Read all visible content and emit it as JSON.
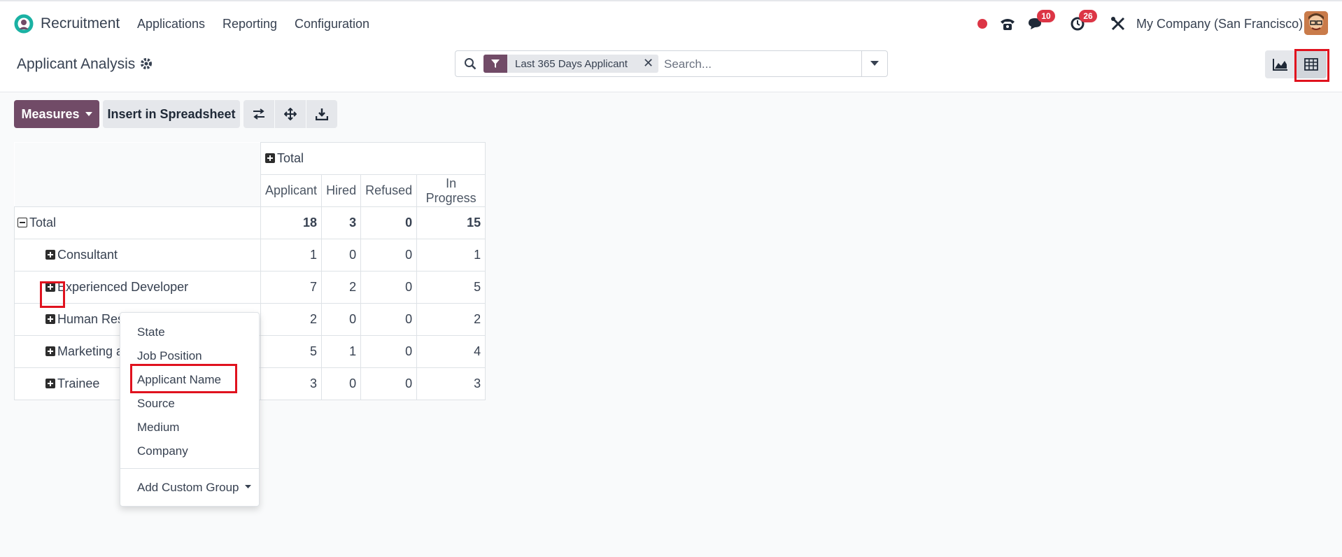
{
  "app": {
    "name": "Recruitment"
  },
  "nav": [
    {
      "label": "Applications"
    },
    {
      "label": "Reporting"
    },
    {
      "label": "Configuration"
    }
  ],
  "systray": {
    "messages_count": "10",
    "activities_count": "26",
    "company": "My Company (San Francisco)"
  },
  "page": {
    "title": "Applicant Analysis"
  },
  "search": {
    "facet_label": "Last 365 Days Applicant",
    "placeholder": "Search..."
  },
  "toolbar": {
    "measures_label": "Measures",
    "insert_label": "Insert in Spreadsheet"
  },
  "pivot": {
    "col_group": "Total",
    "columns": [
      "Applicant",
      "Hired",
      "Refused",
      "In Progress"
    ],
    "total_row": {
      "label": "Total",
      "values": [
        "18",
        "3",
        "0",
        "15"
      ]
    },
    "rows": [
      {
        "label": "Consultant",
        "values": [
          "1",
          "0",
          "0",
          "1"
        ]
      },
      {
        "label": "Experienced Developer",
        "values": [
          "7",
          "2",
          "0",
          "5"
        ]
      },
      {
        "label": "Human Resources Manager",
        "values": [
          "2",
          "0",
          "0",
          "2"
        ]
      },
      {
        "label": "Marketing and Community Manager",
        "values": [
          "5",
          "1",
          "0",
          "4"
        ]
      },
      {
        "label": "Trainee",
        "values": [
          "3",
          "0",
          "0",
          "3"
        ]
      }
    ]
  },
  "groupby_menu": {
    "options": [
      "State",
      "Job Position",
      "Applicant Name",
      "Source",
      "Medium",
      "Company"
    ],
    "custom_label": "Add Custom Group"
  },
  "colors": {
    "brand": "#714b67",
    "highlight": "#e0121e",
    "badge": "#dc3545"
  }
}
